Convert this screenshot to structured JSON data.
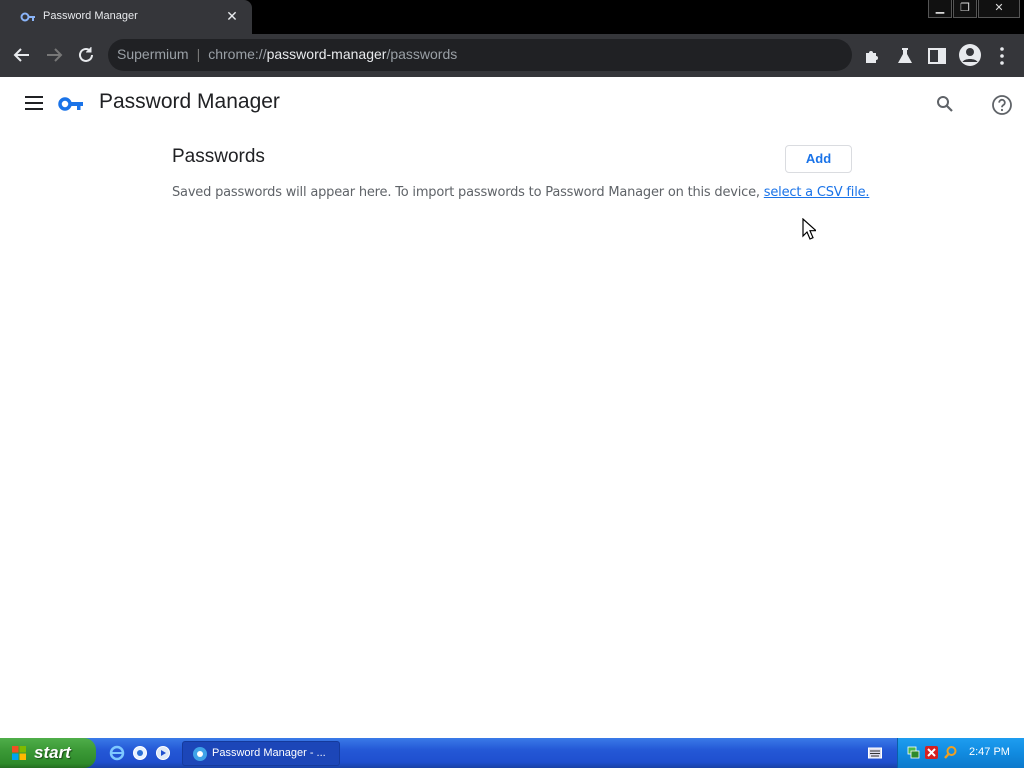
{
  "browser": {
    "tab_title": "Password Manager",
    "omnibox": {
      "app_name": "Supermium",
      "scheme": "chrome://",
      "host": "password-manager",
      "path": "/passwords"
    }
  },
  "page": {
    "app_title": "Password Manager",
    "section_title": "Passwords",
    "add_label": "Add",
    "empty_message": "Saved passwords will appear here. To import passwords to Password Manager on this device, ",
    "csv_link": "select a CSV file."
  },
  "taskbar": {
    "start_label": "start",
    "task_label": "Password Manager - ...",
    "clock": "2:47 PM"
  },
  "colors": {
    "accent": "#1a73e8",
    "chrome_frame": "#35363a",
    "omnibox_bg": "#202124"
  }
}
